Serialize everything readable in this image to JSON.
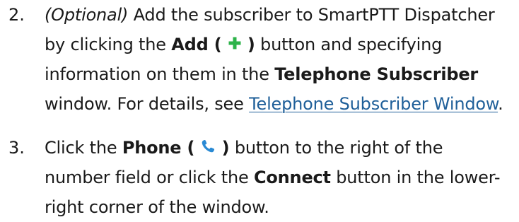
{
  "steps": [
    {
      "number": "2.",
      "optional": "(Optional)",
      "text_a": " Add the subscriber to SmartPTT Dispatcher",
      "text_b": "by clicking the ",
      "button_open": "Add (",
      "button_close": ")",
      "text_c": " button and specifying",
      "text_d": "information on them in the ",
      "window_name": "Telephone Subscriber",
      "text_e": "window. For details, see ",
      "link": "Telephone Subscriber Window",
      "text_f": ".",
      "icon": "plus-icon",
      "icon_color": "#2db34a"
    },
    {
      "number": "3.",
      "text_a": "Click the ",
      "button_open": "Phone (",
      "button_close": ")",
      "text_b": " button to the right of the",
      "text_c": "number field or click the ",
      "connect": "Connect",
      "text_d": " button in the lower-",
      "text_e": "right corner of the window.",
      "icon": "phone-icon",
      "icon_color": "#2a8ad4"
    }
  ]
}
